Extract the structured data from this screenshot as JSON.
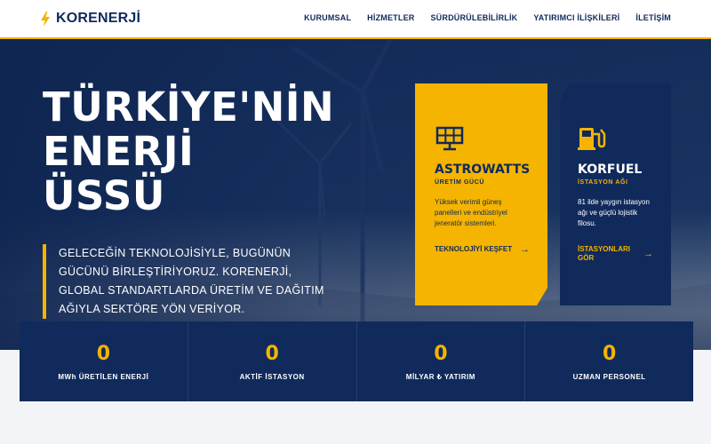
{
  "brand": {
    "name": "KORENERJİ",
    "accent": "#f5b400",
    "navy": "#102a5c"
  },
  "nav": [
    "KURUMSAL",
    "HİZMETLER",
    "SÜRDÜRÜLEBİLİRLİK",
    "YATIRIMCI İLİŞKİLERİ",
    "İLETİŞİM"
  ],
  "hero": {
    "title_lines": [
      "TÜRKİYE'NİN",
      "ENERJİ",
      "ÜSSÜ"
    ],
    "description": "GELECEĞİN TEKNOLOJİSİYLE, BUGÜNÜN GÜCÜNÜ BİRLEŞTİRİYORUZ. KORENERJİ, GLOBAL STANDARTLARDA ÜRETİM VE DAĞITIM AĞIYLA SEKTÖRE YÖN VERİYOR."
  },
  "cards": [
    {
      "icon": "solar-panel-icon",
      "title": "ASTROWATTS",
      "subtitle": "ÜRETİM GÜCÜ",
      "description": "Yüksek verimli güneş panelleri ve endüstriyel jeneratör sistemleri.",
      "link_label": "TEKNOLOJİYİ KEŞFET"
    },
    {
      "icon": "fuel-pump-icon",
      "title": "KORFUEL",
      "subtitle": "İSTASYON AĞI",
      "description": "81 ilde yaygın istasyon ağı ve güçlü lojistik filosu.",
      "link_label": "İSTASYONLARI GÖR"
    }
  ],
  "stats": [
    {
      "value": "0",
      "label": "MWh ÜRETİLEN ENERJİ"
    },
    {
      "value": "0",
      "label": "AKTİF İSTASYON"
    },
    {
      "value": "0",
      "label": "MİLYAR ₺ YATIRIM"
    },
    {
      "value": "0",
      "label": "UZMAN PERSONEL"
    }
  ]
}
